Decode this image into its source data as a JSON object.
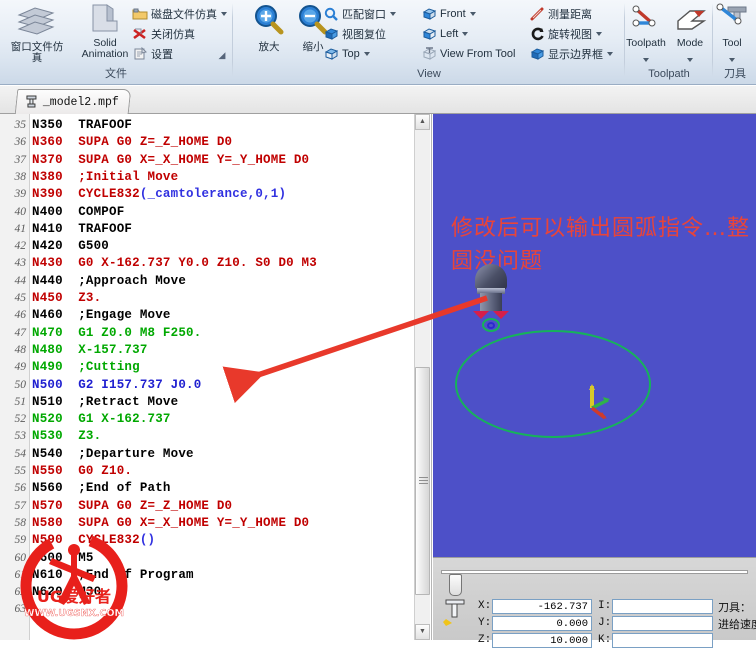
{
  "ribbon": {
    "groups": [
      {
        "name": "file",
        "label": "文件",
        "big": [
          {
            "label": "窗口文件仿真",
            "icon": "window-simulate-icon"
          },
          {
            "label_line1": "Solid",
            "label_line2": "Animation",
            "icon": "solid-animation-icon"
          }
        ],
        "small": [
          {
            "label": "磁盘文件仿真",
            "icon": "folder-icon",
            "dropdown": true
          },
          {
            "label": "关闭仿真",
            "icon": "close-sim-icon",
            "dropdown": false
          },
          {
            "label": "设置",
            "icon": "settings-icon",
            "dropdown": false
          }
        ]
      },
      {
        "name": "view",
        "label": "View",
        "big": [
          {
            "label": "放大",
            "icon": "zoom-in-icon"
          },
          {
            "label": "缩小",
            "icon": "zoom-out-icon"
          }
        ],
        "small": [
          {
            "label": "匹配窗口",
            "icon": "fit-window-icon",
            "dropdown": true
          },
          {
            "label": "视图复位",
            "icon": "view-reset-icon",
            "dropdown": false
          },
          {
            "label": "Top",
            "icon": "view-top-icon",
            "dropdown": true
          },
          {
            "label": "Front",
            "icon": "view-front-icon",
            "dropdown": true
          },
          {
            "label": "Left",
            "icon": "view-left-icon",
            "dropdown": true
          },
          {
            "label": "View From Tool",
            "icon": "view-from-tool-icon",
            "dropdown": false
          },
          {
            "label": "测量距离",
            "icon": "measure-distance-icon",
            "dropdown": false
          },
          {
            "label": "旋转视图",
            "icon": "rotate-view-icon",
            "dropdown": true
          },
          {
            "label": "显示边界框",
            "icon": "show-bounding-box-icon",
            "dropdown": true
          }
        ]
      },
      {
        "name": "toolpath",
        "label": "Toolpath",
        "big": [
          {
            "label": "Toolpath",
            "icon": "toolpath-icon",
            "dropdown": true
          },
          {
            "label": "Mode",
            "icon": "mode-icon",
            "dropdown": true
          }
        ],
        "small": []
      },
      {
        "name": "tool",
        "label": "刀具",
        "big": [
          {
            "label": "Tool",
            "icon": "tool-icon",
            "dropdown": true
          }
        ],
        "small": []
      }
    ]
  },
  "tab": {
    "label": "_model2.mpf",
    "icon": "mpf-file-icon"
  },
  "editor": {
    "first_line_number": 35,
    "lines": [
      {
        "n": 35,
        "tokens": [
          {
            "t": "N350  TRAFOOF",
            "c": "black"
          }
        ]
      },
      {
        "n": 36,
        "tokens": [
          {
            "t": "N360  SUPA G0 Z=_Z_HOME D0",
            "c": "red"
          }
        ]
      },
      {
        "n": 37,
        "tokens": [
          {
            "t": "N370  SUPA G0 X=_X_HOME Y=_Y_HOME D0",
            "c": "red"
          }
        ]
      },
      {
        "n": 38,
        "tokens": [
          {
            "t": "N380  ;Initial Move",
            "c": "red"
          }
        ]
      },
      {
        "n": 39,
        "tokens": [
          {
            "t": "N390  CYCLE832",
            "c": "red"
          },
          {
            "t": "(_camtolerance,0,1)",
            "c": "param"
          }
        ]
      },
      {
        "n": 40,
        "tokens": [
          {
            "t": "N400  COMPOF",
            "c": "black"
          }
        ]
      },
      {
        "n": 41,
        "tokens": [
          {
            "t": "N410  TRAFOOF",
            "c": "black"
          }
        ]
      },
      {
        "n": 42,
        "tokens": [
          {
            "t": "N420  G500",
            "c": "black"
          }
        ]
      },
      {
        "n": 43,
        "tokens": [
          {
            "t": "N430  G0 X-162.737 Y0.0 Z10. S0 D0 M3",
            "c": "red"
          }
        ]
      },
      {
        "n": 44,
        "tokens": [
          {
            "t": "N440  ;Approach Move",
            "c": "black"
          }
        ]
      },
      {
        "n": 45,
        "tokens": [
          {
            "t": "N450  Z3.",
            "c": "red"
          }
        ]
      },
      {
        "n": 46,
        "tokens": [
          {
            "t": "N460  ;Engage Move",
            "c": "black"
          }
        ]
      },
      {
        "n": 47,
        "tokens": [
          {
            "t": "N470  G1 Z0.0 M8 F250.",
            "c": "green"
          }
        ]
      },
      {
        "n": 48,
        "tokens": [
          {
            "t": "N480  X-157.737",
            "c": "green"
          }
        ]
      },
      {
        "n": 49,
        "tokens": [
          {
            "t": "N490  ;Cutting",
            "c": "green"
          }
        ]
      },
      {
        "n": 50,
        "tokens": [
          {
            "t": "N500  G2 I157.737 J0.0",
            "c": "blue"
          }
        ]
      },
      {
        "n": 51,
        "tokens": [
          {
            "t": "N510  ;Retract Move",
            "c": "black"
          }
        ]
      },
      {
        "n": 52,
        "tokens": [
          {
            "t": "N520  G1 X-162.737",
            "c": "green"
          }
        ]
      },
      {
        "n": 53,
        "tokens": [
          {
            "t": "N530  Z3.",
            "c": "green"
          }
        ]
      },
      {
        "n": 54,
        "tokens": [
          {
            "t": "N540  ;Departure Move",
            "c": "black"
          }
        ]
      },
      {
        "n": 55,
        "tokens": [
          {
            "t": "N550  G0 Z10.",
            "c": "red"
          }
        ]
      },
      {
        "n": 56,
        "tokens": [
          {
            "t": "N560  ;End of Path",
            "c": "black"
          }
        ]
      },
      {
        "n": 57,
        "tokens": [
          {
            "t": "N570  SUPA G0 Z=_Z_HOME D0",
            "c": "red"
          }
        ]
      },
      {
        "n": 58,
        "tokens": [
          {
            "t": "N580  SUPA G0 X=_X_HOME Y=_Y_HOME D0",
            "c": "red"
          }
        ]
      },
      {
        "n": 59,
        "tokens": [
          {
            "t": "N590  CYCLE832",
            "c": "red"
          },
          {
            "t": "()",
            "c": "param"
          }
        ]
      },
      {
        "n": 60,
        "tokens": [
          {
            "t": "N600  M5",
            "c": "black"
          }
        ]
      },
      {
        "n": 61,
        "tokens": [
          {
            "t": "N610  ;End of Program",
            "c": "black"
          }
        ]
      },
      {
        "n": 62,
        "tokens": [
          {
            "t": "N620  M30",
            "c": "black"
          }
        ]
      },
      {
        "n": 63,
        "tokens": [
          {
            "t": "",
            "c": "black"
          }
        ]
      }
    ]
  },
  "viewport": {
    "annotation": "修改后可以输出圆弧指令…整圆没问题",
    "annotation_color": "#e8443a",
    "background_color": "#4d50c8",
    "toolpath_color": "#16b35a",
    "tool_icon": "ball-nose-cutter",
    "triad_icon": "axis-triad"
  },
  "status": {
    "coords": [
      {
        "label": "X:",
        "value": "-162.737"
      },
      {
        "label": "Y:",
        "value": "0.000"
      },
      {
        "label": "Z:",
        "value": "10.000"
      }
    ],
    "ijk": [
      {
        "label": "I:",
        "value": ""
      },
      {
        "label": "J:",
        "value": ""
      },
      {
        "label": "K:",
        "value": ""
      }
    ],
    "right_labels": [
      "刀具：",
      "进给速度"
    ]
  },
  "watermark": {
    "text_main": "UG爱好者",
    "text_url": "WWW.UGSNX.COM",
    "color": "#e8201b"
  }
}
